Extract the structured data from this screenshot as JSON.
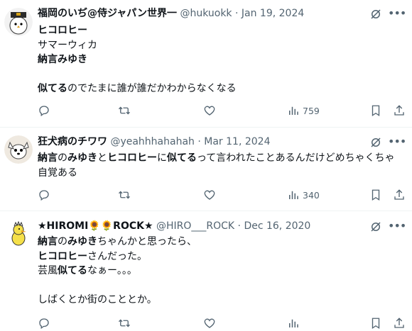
{
  "tweets": [
    {
      "name": "福岡のいぢ@侍ジャパン世界一",
      "handle": "@hukuokk",
      "date": "Jan 19, 2024",
      "segments": [
        {
          "t": "ヒコロヒー",
          "b": true
        },
        {
          "t": "\nサマーウィカ\n",
          "b": false
        },
        {
          "t": "納言みゆき",
          "b": true
        },
        {
          "t": "\n\n",
          "b": false
        },
        {
          "t": "似てる",
          "b": true
        },
        {
          "t": "のでたまに誰が誰だかわからなくなる",
          "b": false
        }
      ],
      "views": "759"
    },
    {
      "name": "狂犬病のチワワ",
      "handle": "@yeahhhahahah",
      "date": "Mar 11, 2024",
      "segments": [
        {
          "t": "納言",
          "b": true
        },
        {
          "t": "の",
          "b": false
        },
        {
          "t": "みゆき",
          "b": true
        },
        {
          "t": "と",
          "b": false
        },
        {
          "t": "ヒコロヒー",
          "b": true
        },
        {
          "t": "に",
          "b": false
        },
        {
          "t": "似てる",
          "b": true
        },
        {
          "t": "って言われたことあるんだけどめちゃくちゃ自覚ある",
          "b": false
        }
      ],
      "views": "340"
    },
    {
      "name": "★HIROMI🌻🌻ROCK★",
      "handle": "@HIRO___ROCK",
      "date": "Dec 16, 2020",
      "segments": [
        {
          "t": "納言",
          "b": true
        },
        {
          "t": "の",
          "b": false
        },
        {
          "t": "みゆき",
          "b": true
        },
        {
          "t": "ちゃんかと思ったら、\n",
          "b": false
        },
        {
          "t": "ヒコロヒー",
          "b": true
        },
        {
          "t": "さんだった。\n芸風",
          "b": false
        },
        {
          "t": "似てる",
          "b": true
        },
        {
          "t": "なぁー。。。\n\nしばくとか街のこととか。",
          "b": false
        }
      ],
      "views": ""
    }
  ],
  "colors": {
    "text": "#0f1419",
    "secondary": "#536471",
    "border": "#eff3f4"
  },
  "icons": [
    "reply-icon",
    "retweet-icon",
    "like-icon",
    "views-icon",
    "bookmark-icon",
    "share-icon",
    "grok-icon",
    "more-icon"
  ]
}
